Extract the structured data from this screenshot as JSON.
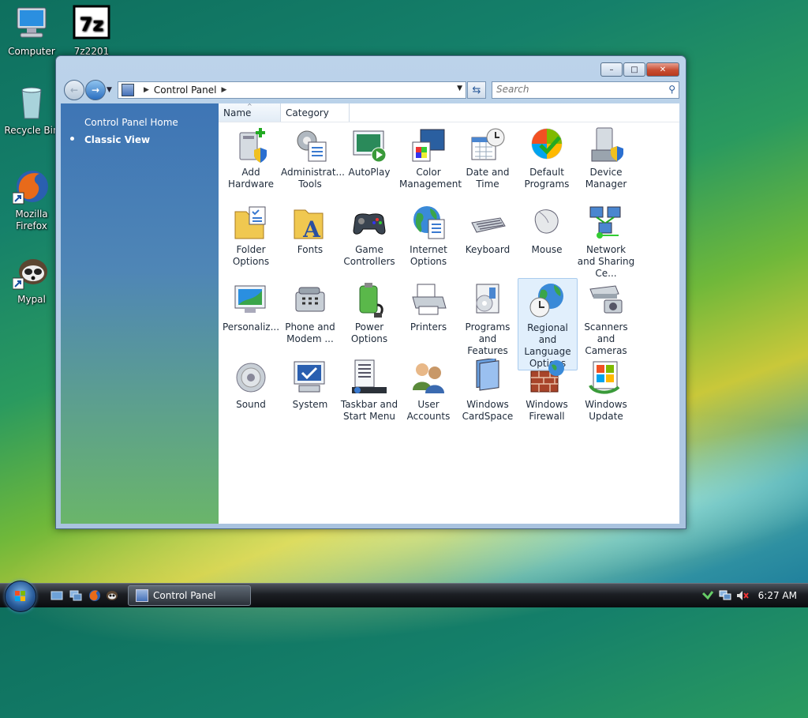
{
  "desktop": {
    "icons": [
      {
        "label": "Computer",
        "icon": "computer-icon"
      },
      {
        "label": "7z2201",
        "icon": "7zip-icon"
      },
      {
        "label": "Recycle Bin",
        "icon": "recycle-bin-icon"
      },
      {
        "label": "Mozilla Firefox",
        "icon": "firefox-icon"
      },
      {
        "label": "Mypal",
        "icon": "mypal-icon"
      }
    ]
  },
  "window": {
    "title": "Control Panel",
    "controls": {
      "minimize": "–",
      "maximize": "□",
      "close": "✕"
    },
    "address": {
      "crumb": "Control Panel"
    },
    "search": {
      "placeholder": "Search"
    },
    "left_pane": {
      "home": "Control Panel Home",
      "classic": "Classic View"
    },
    "columns": {
      "name": "Name",
      "category": "Category"
    },
    "items": [
      {
        "label": "Add Hardware",
        "icon": "add-hardware-icon"
      },
      {
        "label": "Administrat... Tools",
        "icon": "administrative-tools-icon"
      },
      {
        "label": "AutoPlay",
        "icon": "autoplay-icon"
      },
      {
        "label": "Color Management",
        "icon": "color-management-icon"
      },
      {
        "label": "Date and Time",
        "icon": "date-time-icon"
      },
      {
        "label": "Default Programs",
        "icon": "default-programs-icon"
      },
      {
        "label": "Device Manager",
        "icon": "device-manager-icon"
      },
      {
        "label": "Folder Options",
        "icon": "folder-options-icon"
      },
      {
        "label": "Fonts",
        "icon": "fonts-icon"
      },
      {
        "label": "Game Controllers",
        "icon": "game-controller-icon"
      },
      {
        "label": "Internet Options",
        "icon": "internet-options-icon"
      },
      {
        "label": "Keyboard",
        "icon": "keyboard-icon"
      },
      {
        "label": "Mouse",
        "icon": "mouse-icon"
      },
      {
        "label": "Network and Sharing Ce...",
        "icon": "network-icon"
      },
      {
        "label": "Personaliz...",
        "icon": "personalization-icon"
      },
      {
        "label": "Phone and Modem ...",
        "icon": "phone-modem-icon"
      },
      {
        "label": "Power Options",
        "icon": "power-options-icon"
      },
      {
        "label": "Printers",
        "icon": "printer-icon"
      },
      {
        "label": "Programs and Features",
        "icon": "programs-features-icon"
      },
      {
        "label": "Regional and Language Options",
        "icon": "regional-language-icon",
        "selected": true
      },
      {
        "label": "Scanners and Cameras",
        "icon": "scanner-camera-icon"
      },
      {
        "label": "Sound",
        "icon": "sound-icon"
      },
      {
        "label": "System",
        "icon": "system-icon"
      },
      {
        "label": "Taskbar and Start Menu",
        "icon": "taskbar-start-menu-icon"
      },
      {
        "label": "User Accounts",
        "icon": "user-accounts-icon"
      },
      {
        "label": "Windows CardSpace",
        "icon": "cardspace-icon"
      },
      {
        "label": "Windows Firewall",
        "icon": "firewall-icon"
      },
      {
        "label": "Windows Update",
        "icon": "windows-update-icon"
      }
    ]
  },
  "taskbar": {
    "task": "Control Panel",
    "clock": "6:27 AM"
  },
  "colors": {
    "accent": "#3e75b5",
    "close": "#c74d32"
  }
}
